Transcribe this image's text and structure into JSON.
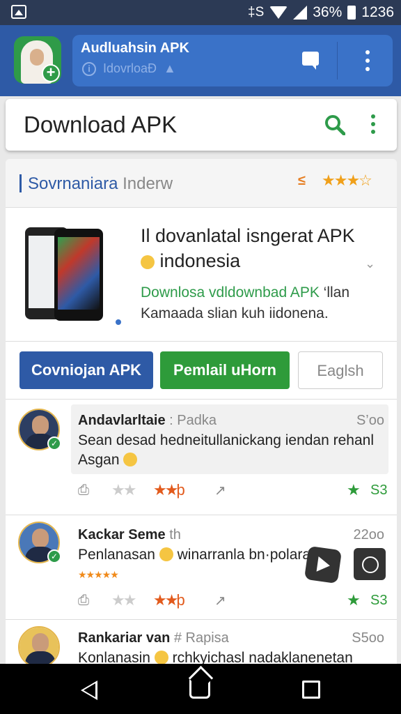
{
  "status_bar": {
    "battery": "36%",
    "time": "1236",
    "bt_glyph": "‡S"
  },
  "app_header": {
    "title": "Audluahsin APK",
    "subtitle": "IdovrloaĐ",
    "icons": [
      "info-icon",
      "thumbs-up-icon",
      "chat-icon",
      "more-vert-icon"
    ]
  },
  "search": {
    "title": "Download  APK",
    "icons": [
      "search-icon",
      "more-vert-icon"
    ],
    "colors": {
      "icon": "#2e9b4a"
    }
  },
  "panel": {
    "head_title": "Sovrnaniara",
    "head_title_muted": " Inderw",
    "head_list_icon": "≤",
    "head_stars": "★★★☆"
  },
  "hero": {
    "title": "Il dovanlatal isngerat APK",
    "title_line2": "indonesia",
    "green_text": "Downlosa vdldownbad APK",
    "green_suffix": " ‘llan",
    "desc": "Kamaada slian kuh iidonena."
  },
  "buttons": {
    "primary": "Covniojan APK",
    "secondary": "Pemlail uHorn",
    "tertiary": "Eaglsh"
  },
  "comments": [
    {
      "name": "Andavlarltaie",
      "handle": " :  Padka",
      "time": "S’oo",
      "text": "Sean desad hedneitullanickang iendan rehanl Asgan",
      "stars_grey": "★★",
      "stars_orange": "★★þ",
      "share": "↗",
      "count": "S3"
    },
    {
      "name": "Kackar Seme",
      "handle": " th",
      "time": "22oo",
      "text": "Penlanasan",
      "text_after": " winarranla bn·polaraydh",
      "mini_stars": "★★★★★",
      "stars_grey": "★★",
      "stars_orange": "★★þ",
      "share": "↗",
      "count": "S3"
    },
    {
      "name": "Rankariar van",
      "handle": " #  Rapisa",
      "time": "S5oo",
      "text": "Konlanasin",
      "text_after": " rchkyichasl nadaklanenetan"
    }
  ],
  "nav": {
    "icons": [
      "back-icon",
      "home-icon",
      "recent-apps-icon"
    ]
  }
}
